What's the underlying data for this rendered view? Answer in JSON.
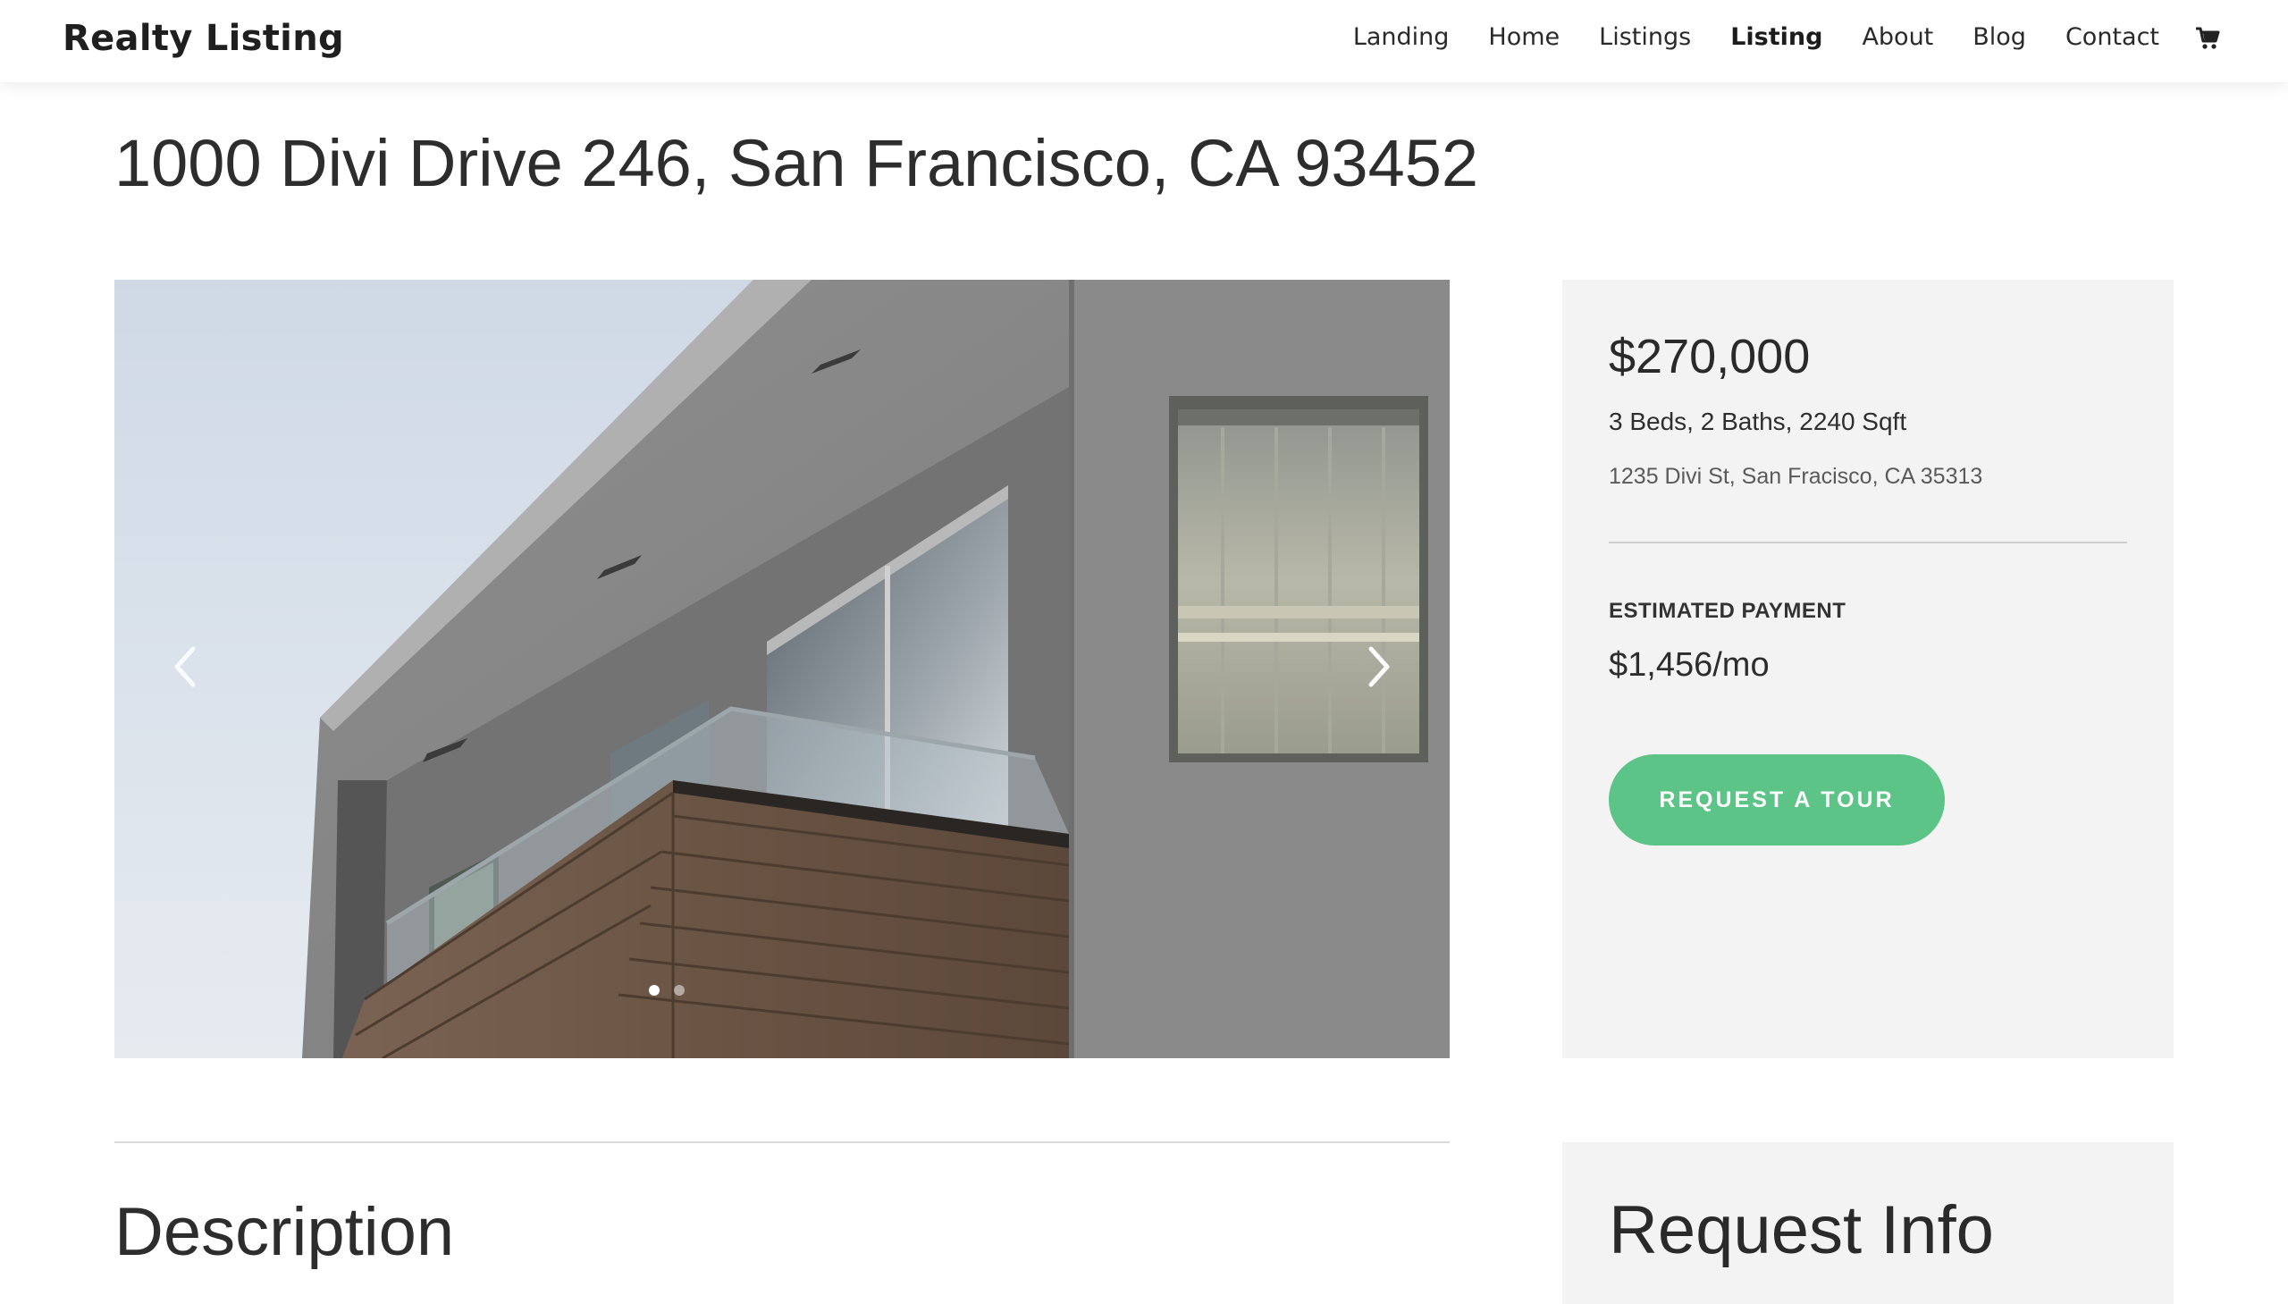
{
  "site": {
    "logo": "Realty Listing"
  },
  "nav": {
    "items": [
      {
        "label": "Landing",
        "active": false
      },
      {
        "label": "Home",
        "active": false
      },
      {
        "label": "Listings",
        "active": false
      },
      {
        "label": "Listing",
        "active": true
      },
      {
        "label": "About",
        "active": false
      },
      {
        "label": "Blog",
        "active": false
      },
      {
        "label": "Contact",
        "active": false
      }
    ],
    "cart_icon": "shopping-cart-icon"
  },
  "listing": {
    "title": "1000 Divi Drive 246, San Francisco, CA 93452",
    "price": "$270,000",
    "specs": "3 Beds, 2 Baths, 2240 Sqft",
    "address": "1235 Divi St, San Fracisco, CA 35313",
    "estimated_payment_label": "ESTIMATED PAYMENT",
    "estimated_payment_value": "$1,456/mo",
    "cta_label": "REQUEST A TOUR"
  },
  "slider": {
    "slide_count": 2,
    "active_slide": 1,
    "prev_icon": "chevron-left-icon",
    "next_icon": "chevron-right-icon"
  },
  "sections": {
    "description_title": "Description",
    "request_info_title": "Request Info"
  },
  "colors": {
    "accent": "#5bc486",
    "card_bg": "#f3f3f3",
    "text": "#2d2d2d"
  }
}
